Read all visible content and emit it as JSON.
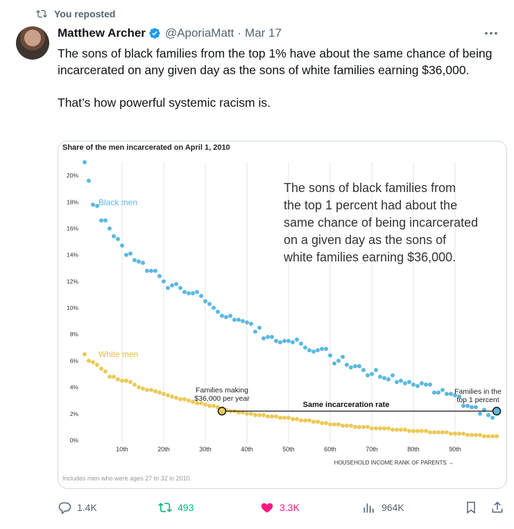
{
  "repost_banner": "You reposted",
  "author": {
    "name": "Matthew Archer",
    "handle": "@AporiaMatt",
    "date": "Mar 17"
  },
  "tweet_text": "The sons of black families from the top 1% have about the same chance of being incarcerated on any given day as the sons of white families earning $36,000.\n\nThat’s how powerful systemic racism is.",
  "actions": {
    "replies": "1.4K",
    "reposts": "493",
    "likes": "3.3K",
    "views": "964K"
  },
  "colors": {
    "accent": "#1d9bf0",
    "repost": "#00ba7c",
    "like": "#f91880",
    "black_series": "#5bb8e0",
    "white_series": "#ecc957"
  },
  "chart_data": {
    "type": "scatter",
    "title": "Share of the men incarcerated on April 1, 2010",
    "xlabel": "HOUSEHOLD INCOME RANK OF PARENTS →",
    "ylabel": "",
    "x_ticks": [
      "10th",
      "20th",
      "30th",
      "40th",
      "50th",
      "60th",
      "70th",
      "80th",
      "90th"
    ],
    "y_ticks": [
      "0%",
      "2%",
      "4%",
      "6%",
      "8%",
      "10%",
      "12%",
      "14%",
      "16%",
      "18%",
      "20%"
    ],
    "xlim": [
      1,
      100
    ],
    "ylim": [
      0,
      21
    ],
    "annotation": "The sons of black families from the top 1 percent had about the same chance of being incarcerated on a given day as the sons of white families earning $36,000.",
    "label_families_making": "Families making\n$36,000 per year",
    "label_top1": "Families in the\ntop 1 percent",
    "label_same_rate": "Same incarceration rate",
    "footnote": "Includes men who were ages 27 to 32 in 2010.",
    "series": [
      {
        "name": "Black men",
        "values": [
          21.0,
          19.6,
          17.8,
          17.7,
          16.6,
          16.6,
          16.0,
          15.4,
          15.2,
          14.7,
          14.0,
          14.1,
          13.6,
          13.5,
          13.4,
          12.8,
          12.8,
          12.8,
          12.4,
          12.0,
          11.5,
          11.7,
          11.8,
          11.5,
          11.2,
          11.1,
          11.1,
          11.2,
          10.9,
          10.5,
          10.3,
          10.0,
          9.7,
          9.4,
          9.3,
          9.4,
          9.1,
          9.1,
          9.0,
          8.9,
          8.8,
          8.2,
          8.5,
          7.7,
          7.8,
          7.8,
          7.5,
          7.4,
          7.5,
          7.5,
          7.4,
          7.6,
          7.3,
          7.0,
          6.8,
          6.7,
          6.8,
          6.9,
          6.9,
          6.4,
          5.8,
          6.0,
          6.3,
          5.7,
          5.5,
          5.6,
          5.6,
          5.3,
          4.9,
          5.0,
          5.3,
          4.8,
          4.7,
          4.6,
          4.9,
          4.4,
          4.5,
          4.3,
          4.4,
          4.2,
          4.1,
          4.3,
          4.2,
          4.2,
          3.6,
          3.6,
          3.8,
          3.5,
          3.5,
          3.4,
          3.3,
          2.6,
          2.6,
          2.5,
          2.5,
          2.0,
          2.3,
          1.9,
          1.7,
          2.2
        ]
      },
      {
        "name": "White men",
        "values": [
          6.5,
          6.0,
          5.9,
          5.7,
          5.4,
          5.2,
          4.8,
          4.8,
          4.6,
          4.5,
          4.5,
          4.4,
          4.2,
          4.0,
          3.9,
          3.8,
          3.8,
          3.7,
          3.6,
          3.5,
          3.4,
          3.3,
          3.2,
          3.1,
          3.1,
          3.0,
          2.9,
          2.8,
          2.8,
          2.7,
          2.6,
          2.6,
          2.5,
          2.4,
          2.3,
          2.2,
          2.2,
          2.1,
          2.1,
          2.0,
          2.0,
          1.9,
          1.9,
          1.9,
          1.8,
          1.8,
          1.8,
          1.7,
          1.7,
          1.7,
          1.6,
          1.6,
          1.5,
          1.5,
          1.5,
          1.4,
          1.4,
          1.3,
          1.3,
          1.2,
          1.2,
          1.2,
          1.1,
          1.1,
          1.1,
          1.0,
          1.0,
          1.0,
          1.0,
          0.9,
          0.9,
          0.9,
          0.9,
          0.9,
          0.8,
          0.8,
          0.8,
          0.8,
          0.7,
          0.7,
          0.7,
          0.7,
          0.7,
          0.6,
          0.6,
          0.6,
          0.6,
          0.6,
          0.5,
          0.5,
          0.5,
          0.5,
          0.4,
          0.4,
          0.4,
          0.4,
          0.3,
          0.3,
          0.3,
          0.3
        ]
      }
    ],
    "highlight": {
      "white_x": 34,
      "black_x": 100,
      "rate": 2.2
    }
  }
}
